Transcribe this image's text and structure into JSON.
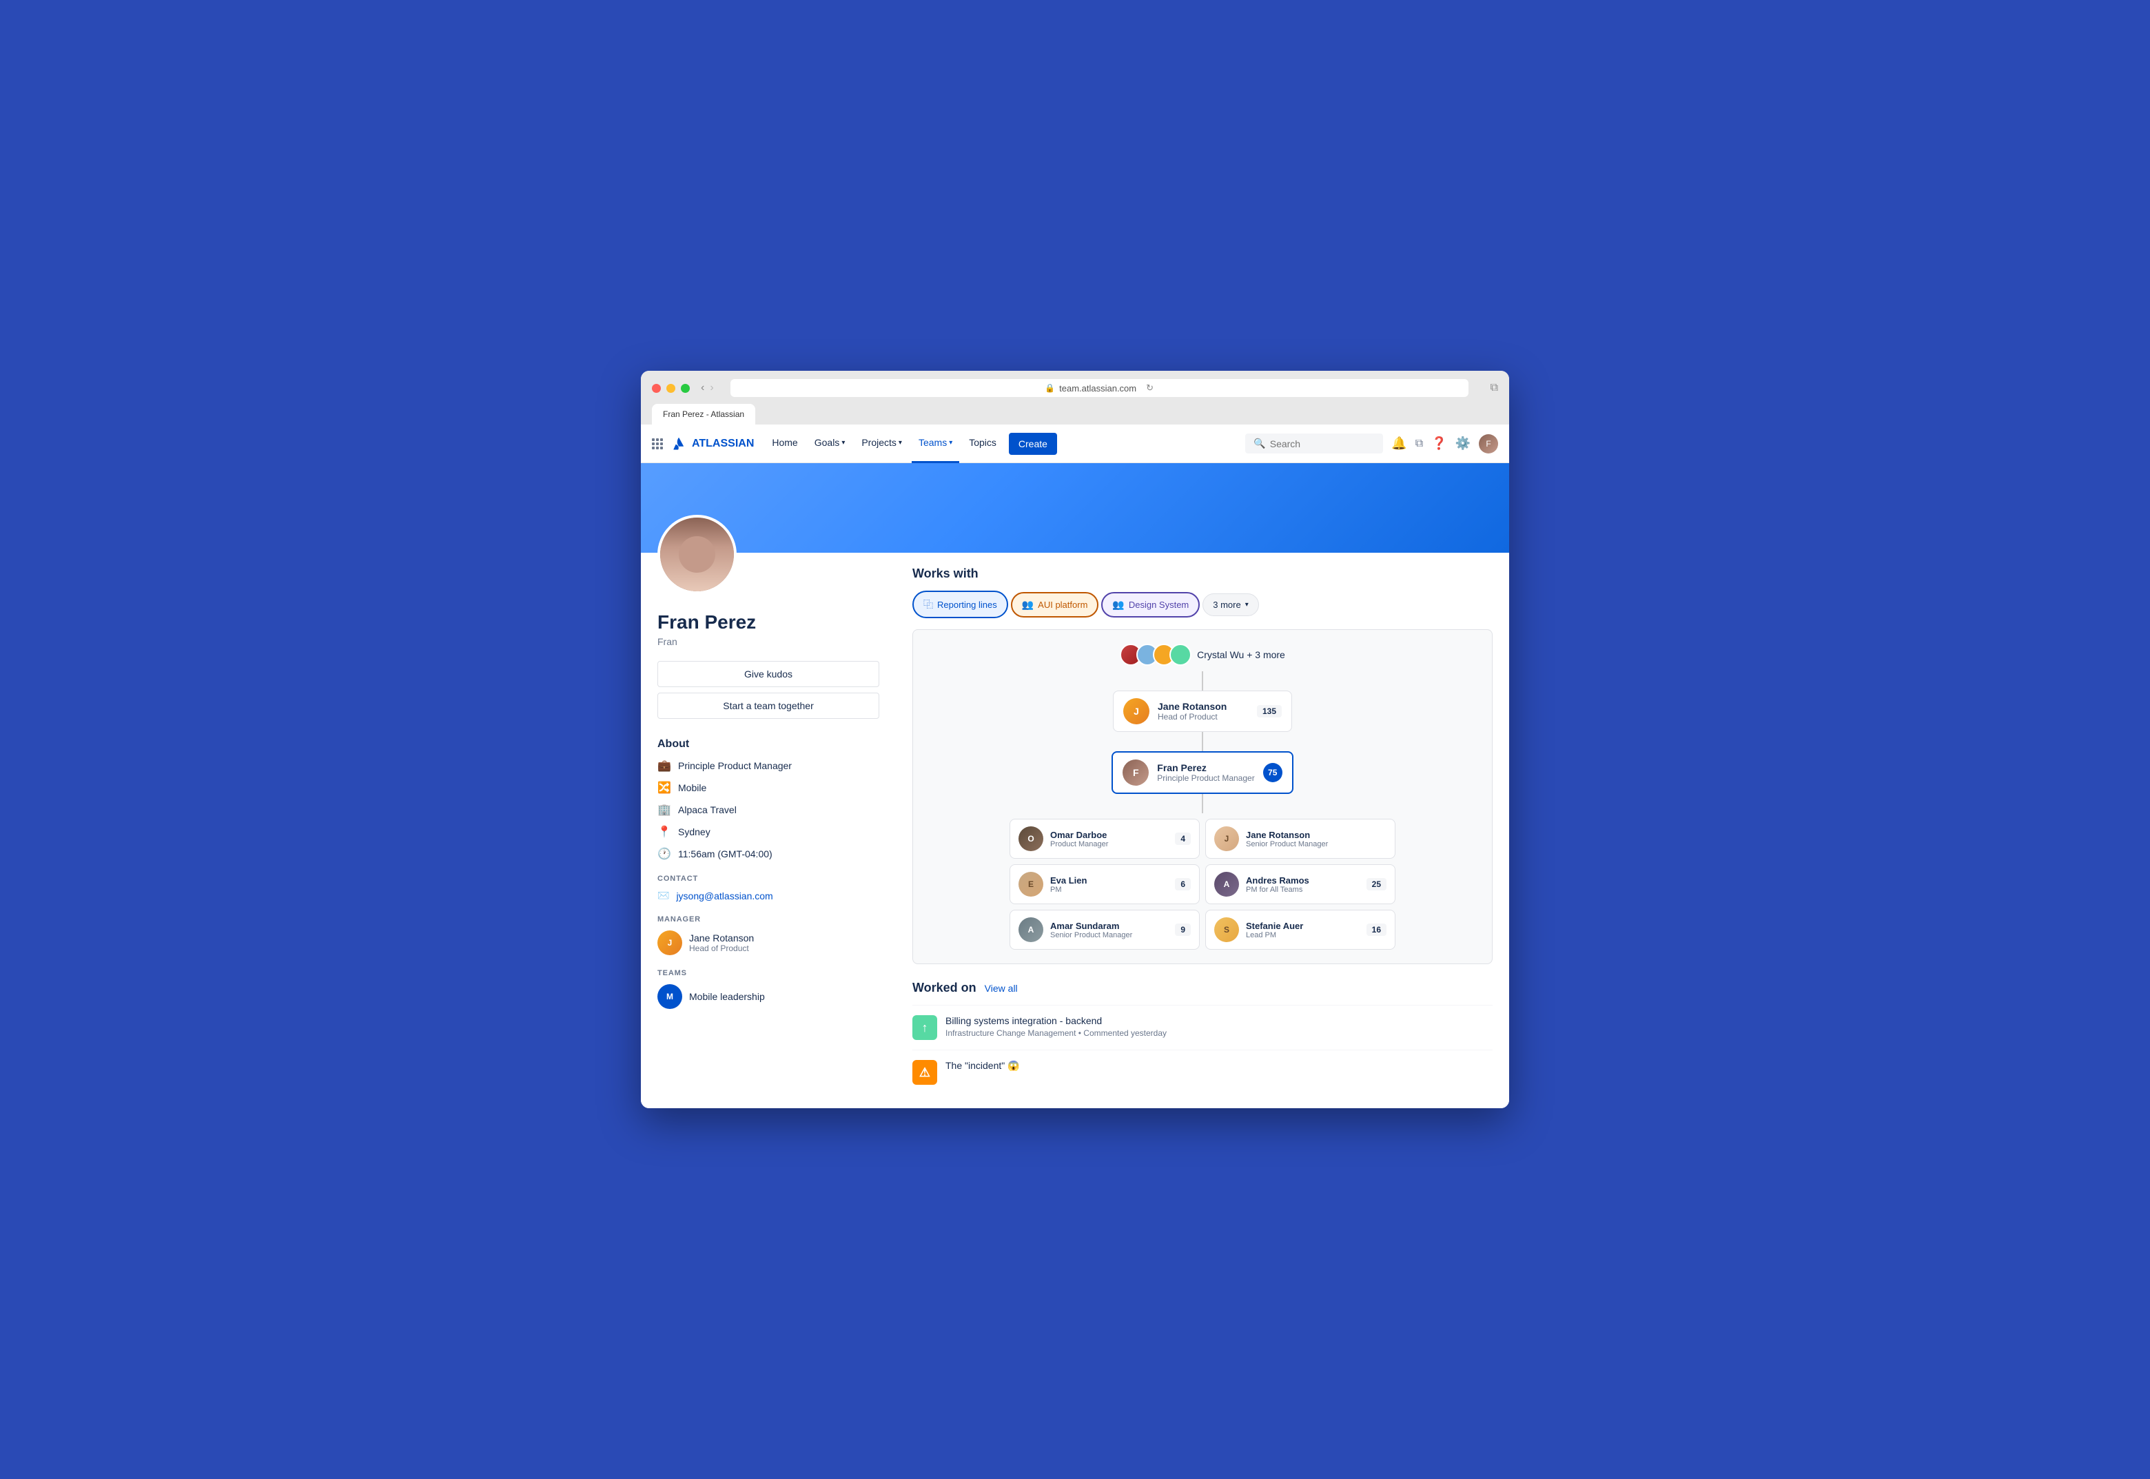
{
  "browser": {
    "url": "team.atlassian.com",
    "tab_label": "Fran Perez - Atlassian"
  },
  "navbar": {
    "logo": "ATLASSIAN",
    "items": [
      {
        "label": "Home",
        "active": false
      },
      {
        "label": "Goals",
        "active": false,
        "has_dropdown": true
      },
      {
        "label": "Projects",
        "active": false,
        "has_dropdown": true
      },
      {
        "label": "Teams",
        "active": true,
        "has_dropdown": true
      },
      {
        "label": "Topics",
        "active": false
      }
    ],
    "create_button": "Create",
    "search_placeholder": "Search"
  },
  "profile": {
    "name": "Fran Perez",
    "username": "Fran",
    "role": "Principle Product Manager",
    "kudos_button": "Give kudos",
    "team_button": "Start a team together",
    "about_section": "About",
    "about_items": [
      {
        "icon": "briefcase",
        "text": "Principle Product Manager"
      },
      {
        "icon": "sitemap",
        "text": "Mobile"
      },
      {
        "icon": "building",
        "text": "Alpaca Travel"
      },
      {
        "icon": "map-pin",
        "text": "Sydney"
      },
      {
        "icon": "clock",
        "text": "11:56am (GMT-04:00)"
      }
    ],
    "contact_label": "CONTACT",
    "contact_email": "jysong@atlassian.com",
    "manager_label": "MANAGER",
    "manager": {
      "name": "Jane Rotanson",
      "role": "Head of Product"
    },
    "teams_label": "TEAMS",
    "team_name": "Mobile leadership"
  },
  "works_with": {
    "title": "Works with",
    "tabs": [
      {
        "label": "Reporting lines",
        "icon": "sitemap",
        "style": "blue"
      },
      {
        "label": "AUI platform",
        "icon": "users-orange",
        "style": "orange"
      },
      {
        "label": "Design System",
        "icon": "users-purple",
        "style": "purple"
      },
      {
        "label": "3 more",
        "icon": "chevron-down",
        "style": "more"
      }
    ]
  },
  "org_chart": {
    "top_group": "Crystal Wu + 3 more",
    "manager": {
      "name": "Jane Rotanson",
      "role": "Head of Product",
      "badge": "135"
    },
    "current_user": {
      "name": "Fran Perez",
      "role": "Principle Product Manager",
      "badge": "75"
    },
    "direct_reports": [
      {
        "name": "Omar Darboe",
        "role": "Product Manager",
        "badge": "4"
      },
      {
        "name": "Jane Rotanson",
        "role": "Senior Product Manager",
        "badge": null
      },
      {
        "name": "Eva Lien",
        "role": "PM",
        "badge": "6"
      },
      {
        "name": "Andres Ramos",
        "role": "PM for All Teams",
        "badge": "25"
      },
      {
        "name": "Amar Sundaram",
        "role": "Senior Product Manager",
        "badge": "9"
      },
      {
        "name": "Stefanie Auer",
        "role": "Lead PM",
        "badge": "16"
      }
    ]
  },
  "worked_on": {
    "title": "Worked on",
    "view_all": "View all",
    "items": [
      {
        "icon": "arrow-up",
        "icon_style": "green",
        "title": "Billing systems integration - backend",
        "meta": "Infrastructure Change Management • Commented yesterday"
      },
      {
        "icon": "warning",
        "icon_style": "orange",
        "title": "The \"incident\" 😱",
        "meta": ""
      }
    ]
  }
}
